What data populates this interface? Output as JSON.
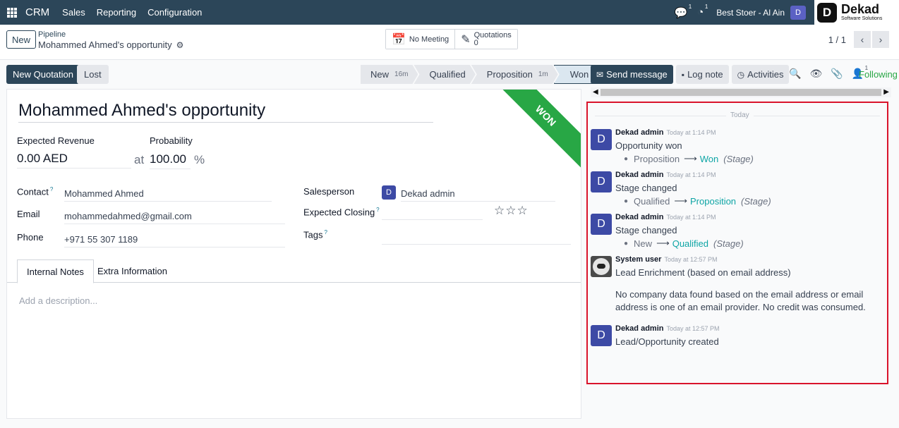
{
  "navbar": {
    "app_name": "CRM",
    "menu": [
      "Sales",
      "Reporting",
      "Configuration"
    ],
    "messages_count": "1",
    "activities_count": "1",
    "company": "Best Stoer - Al Ain",
    "user_initial": "D",
    "logo": {
      "mark": "D",
      "name": "Dekad",
      "tagline": "Software Solutions"
    }
  },
  "control": {
    "new_label": "New",
    "breadcrumb": "Pipeline",
    "record_title": "Mohammed Ahmed's opportunity",
    "meetings_label": "No Meeting",
    "quotations_label": "Quotations",
    "quotations_count": "0",
    "pager": "1 / 1"
  },
  "actions": {
    "new_quotation": "New Quotation",
    "lost": "Lost"
  },
  "stages": [
    {
      "label": "New",
      "duration": "16m",
      "active": false
    },
    {
      "label": "Qualified",
      "duration": "",
      "active": false
    },
    {
      "label": "Proposition",
      "duration": "1m",
      "active": false
    },
    {
      "label": "Won",
      "duration": "",
      "active": true
    }
  ],
  "form": {
    "ribbon": "WON",
    "name": "Mohammed Ahmed's opportunity",
    "expected_revenue_label": "Expected Revenue",
    "expected_revenue": "0.00",
    "currency": "AED",
    "at_label": "at",
    "probability_label": "Probability",
    "probability": "100.00",
    "percent": "%",
    "contact_label": "Contact",
    "contact": "Mohammed Ahmed",
    "email_label": "Email",
    "email": "mohammedahmed@gmail.com",
    "phone_label": "Phone",
    "phone": "+971 55 307 1189",
    "salesperson_label": "Salesperson",
    "salesperson": "Dekad admin",
    "salesperson_initial": "D",
    "expected_closing_label": "Expected Closing",
    "tags_label": "Tags",
    "help_mark": "?",
    "stars": "☆☆☆",
    "priority_stars": 0,
    "tabs": [
      "Internal Notes",
      "Extra Information"
    ],
    "description_placeholder": "Add a description..."
  },
  "chatter": {
    "send_message": "Send message",
    "log_note": "Log note",
    "activities": "Activities",
    "attachments_count": "",
    "followers_count": "1",
    "following": "Following",
    "today_label": "Today",
    "messages": [
      {
        "author": "Dekad admin",
        "time": "Today at 1:14 PM",
        "initial": "D",
        "body": "Opportunity won",
        "old": "Proposition",
        "new": "Won",
        "field": "(Stage)"
      },
      {
        "author": "Dekad admin",
        "time": "Today at 1:14 PM",
        "initial": "D",
        "body": "Stage changed",
        "old": "Qualified",
        "new": "Proposition",
        "field": "(Stage)"
      },
      {
        "author": "Dekad admin",
        "time": "Today at 1:14 PM",
        "initial": "D",
        "body": "Stage changed",
        "old": "New",
        "new": "Qualified",
        "field": "(Stage)"
      },
      {
        "author": "System user",
        "time": "Today at 12:57 PM",
        "body": "Lead Enrichment (based on email address)",
        "extra": "No company data found based on the email address or email address is one of an email provider. No credit was consumed."
      },
      {
        "author": "Dekad admin",
        "time": "Today at 12:57 PM",
        "initial": "D",
        "body": "Lead/Opportunity created"
      }
    ]
  },
  "colors": {
    "navbar": "#2c4659",
    "won_ribbon": "#28a745",
    "highlight_border": "#d9132b",
    "avatar": "#3d4aa5"
  }
}
